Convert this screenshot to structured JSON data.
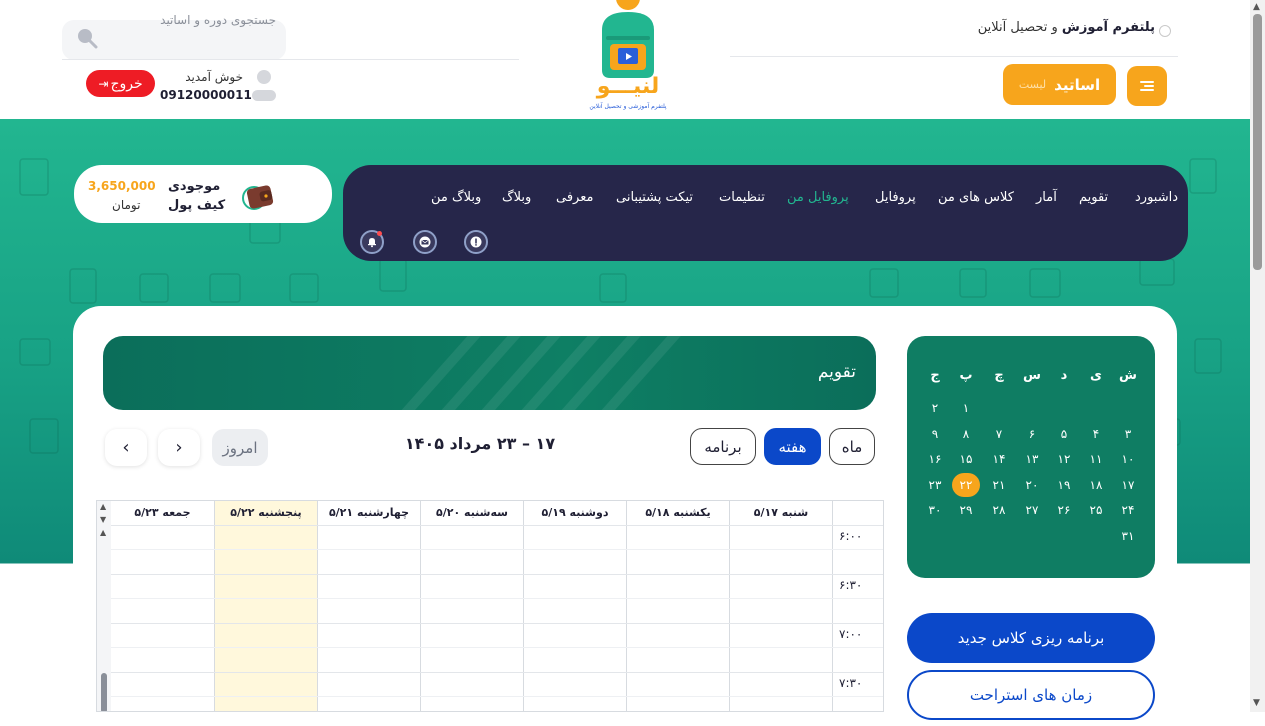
{
  "header": {
    "brand_bold": "پلتفرم آموزش",
    "brand_rest": " و تحصیل آنلاین",
    "teachers_button": "اساتید",
    "teachers_prefix": "لیست",
    "logo_text": "لنیـــو",
    "logo_sub": "پلتفرم آموزشی و تحصیل آنلاین",
    "search_placeholder": "جستجوی دوره و اساتید",
    "welcome": "خوش آمدید",
    "phone": "09120000011",
    "logout": "خروج"
  },
  "nav": {
    "items": [
      "داشبورد",
      "تقویم",
      "آمار",
      "کلاس های من",
      "پروفایل",
      "پروفایل من",
      "تنظیمات",
      "تیکت پشتیبانی",
      "معرفی",
      "وبلاگ",
      "وبلاگ من"
    ],
    "active_index": 5,
    "icons": [
      "info-icon",
      "message-icon",
      "bell-icon"
    ]
  },
  "wallet": {
    "title": "موجودی",
    "title2": "کیف پول",
    "amount": "3,650,000",
    "unit": "تومان"
  },
  "mini_calendar": {
    "weekdays": [
      "ش",
      "ی",
      "د",
      "س",
      "چ",
      "پ",
      "ج"
    ],
    "weeks": [
      [
        "",
        "",
        "",
        "",
        "",
        "۱",
        "۲"
      ],
      [
        "۳",
        "۴",
        "۵",
        "۶",
        "۷",
        "۸",
        "۹"
      ],
      [
        "۱۰",
        "۱۱",
        "۱۲",
        "۱۳",
        "۱۴",
        "۱۵",
        "۱۶"
      ],
      [
        "۱۷",
        "۱۸",
        "۱۹",
        "۲۰",
        "۲۱",
        "۲۲",
        "۲۳"
      ],
      [
        "۲۴",
        "۲۵",
        "۲۶",
        "۲۷",
        "۲۸",
        "۲۹",
        "۳۰"
      ],
      [
        "۳۱",
        "",
        "",
        "",
        "",
        "",
        ""
      ]
    ],
    "today": "۲۲"
  },
  "buttons": {
    "new_class": "برنامه ریزی کلاس جدید",
    "rest_times": "زمان های استراحت"
  },
  "calendar": {
    "title": "تقویم",
    "views": [
      "ماه",
      "هفته",
      "برنامه"
    ],
    "active_view": "هفته",
    "range": "۱۷ – ۲۳ مرداد ۱۴۰۵",
    "today_button": "امروز",
    "days": [
      "شنبه ۵/۱۷",
      "یکشنبه ۵/۱۸",
      "دوشنبه ۵/۱۹",
      "سه‌شنبه ۵/۲۰",
      "چهارشنبه ۵/۲۱",
      "پنجشنبه ۵/۲۲",
      "جمعه ۵/۲۳"
    ],
    "highlight_day_index": 5,
    "times": [
      "۶:۰۰",
      "۶:۳۰",
      "۷:۰۰",
      "۷:۳۰"
    ]
  },
  "colors": {
    "brand_green": "#22b690",
    "accent_orange": "#f7a51c",
    "nav_dark": "#26264a",
    "primary_blue": "#0b48c9",
    "logout_red": "#ee1c25"
  }
}
